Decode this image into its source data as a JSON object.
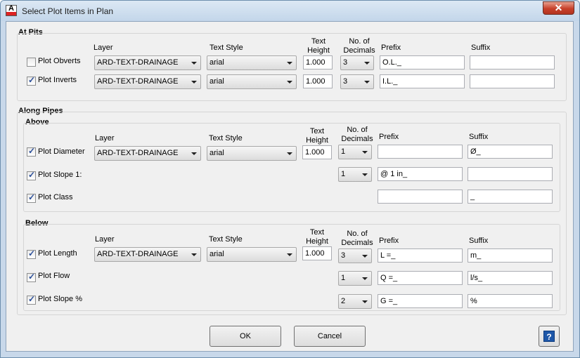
{
  "window": {
    "title": "Select Plot Items in Plan",
    "app_icon_letter": "A"
  },
  "headers": {
    "layer": "Layer",
    "text_style": "Text Style",
    "text_height": [
      "Text",
      "Height"
    ],
    "decimals": [
      "No. of",
      "Decimals"
    ],
    "prefix": "Prefix",
    "suffix": "Suffix"
  },
  "at_pits": {
    "title": "At Pits",
    "rows": [
      {
        "label": "Plot Obverts",
        "checked": false,
        "layer": "ARD-TEXT-DRAINAGE",
        "style": "arial",
        "height": "1.000",
        "decimals": "3",
        "prefix": "O.L._",
        "suffix": ""
      },
      {
        "label": "Plot Inverts",
        "checked": true,
        "layer": "ARD-TEXT-DRAINAGE",
        "style": "arial",
        "height": "1.000",
        "decimals": "3",
        "prefix": "I.L._",
        "suffix": ""
      }
    ]
  },
  "along_pipes": {
    "title": "Along Pipes",
    "above": {
      "title": "Above",
      "rows": [
        {
          "label": "Plot Diameter",
          "checked": true,
          "layer": "ARD-TEXT-DRAINAGE",
          "style": "arial",
          "height": "1.000",
          "decimals": "1",
          "prefix": "",
          "suffix": "Ø_"
        },
        {
          "label": "Plot Slope 1:",
          "checked": true,
          "decimals": "1",
          "prefix": "@ 1 in_",
          "suffix": ""
        },
        {
          "label": "Plot Class",
          "checked": true,
          "prefix": "",
          "suffix": "_"
        }
      ]
    },
    "below": {
      "title": "Below",
      "rows": [
        {
          "label": "Plot Length",
          "checked": true,
          "layer": "ARD-TEXT-DRAINAGE",
          "style": "arial",
          "height": "1.000",
          "decimals": "3",
          "prefix": "L =_",
          "suffix": "m_"
        },
        {
          "label": "Plot Flow",
          "checked": true,
          "decimals": "1",
          "prefix": "Q =_",
          "suffix": "l/s_"
        },
        {
          "label": "Plot Slope %",
          "checked": true,
          "decimals": "2",
          "prefix": "G =_",
          "suffix": "%"
        }
      ]
    }
  },
  "buttons": {
    "ok": "OK",
    "cancel": "Cancel",
    "help": "?"
  },
  "colors": {
    "check_mark": "#2b4f9a",
    "close_button": "#c7402a",
    "help_button": "#1e57a8"
  }
}
